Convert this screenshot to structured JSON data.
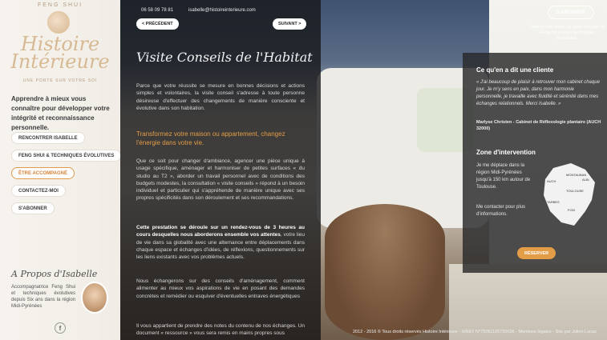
{
  "sidebar": {
    "logo_top": "FENG SHUI",
    "logo_title_line1": "Histoire",
    "logo_title_line2": "Intérieure",
    "logo_sub": "UNE PORTE SUR VOTRE SOI",
    "intro": "Apprendre à mieux vous connaître pour développer votre intégrité et reconnaissance personnelle.",
    "nav": [
      {
        "label": "RENCONTRER ISABELLE"
      },
      {
        "label": "FENG SHUI & TECHNIQUES ÉVOLUTIVES"
      },
      {
        "label": "ÊTRE ACCOMPAGNÉ"
      },
      {
        "label": "CONTACTEZ-MOI"
      },
      {
        "label": "S'ABONNER"
      }
    ],
    "about_title": "A Propos d'Isabelle",
    "about_text": "Accompagnatrice Feng Shui et techniques évolutives depuis Six ans dans la région Midi-Pyrénées",
    "facebook_icon": "f"
  },
  "main": {
    "phone": "06 58 09 78 81",
    "email": "isabelle@histoireinterieure.com",
    "prev_label": "< PRÉCÉDENT",
    "next_label": "SUIVANT >",
    "title": "Visite Conseils de l'Habitat",
    "p1": "Parce que votre réussite se mesure en bonnes décisions et actions simples et volontaires, la visite conseil s'adresse à toute personne désireuse d'effectuer des changements de manière consciente et évolutive dans son habitation.",
    "highlight": "Transformez votre maison ou appartement, changez l'énergie dans votre vie.",
    "p2": "Que ce soit pour changer d'ambiance, agencer une pièce unique à usage spécifique, aménager et harmoniser de petites surfaces « du studio au T2 », aborder un travail personnel avec de conditions des budgets modestes, la consultation « visite conseils » répond à un besoin individuel et particulier qui s'appréhende de manière unique avec ses propres spécificités dans son déroulement et ses recommandations.",
    "p3_bold": "Cette prestation se déroule sur un rendez-vous de 3 heures au cours desquelles nous aborderons ensemble vos attentes",
    "p3_rest": ", votre lieu de vie dans sa globalité avec une alternance entre déplacements dans chaque espace et échanges d'idées, de réflexions, questionnements sur les liens existants avec vos problèmes actuels.",
    "p4": "Nous échangerons sur des conseils d'aménagement, comment alimenter au mieux vos aspirations de vie en posant des demandes concrètes et remédier ou esquiver d'éventuelles entraves énergétiques",
    "p5": "Il vous appartient de prendre des notes du contenu de nos échanges. Un document « ressource » vous sera remis en mains propres sous"
  },
  "right": {
    "testimonial_heading": "Ce qu'en a dit une cliente",
    "quote": "« J'ai beaucoup de plaisir à retrouver mon cabinet chaque jour. Je m'y sens en paix, dans mon harmonie personnelle, je travaille avec fluidité et sérénité dans mes échanges relationnels. Merci Isabelle. »",
    "cite": "Marlyse Christen - Cabinet de Réflexologie plantaire (AUCH 32000)",
    "zone_heading": "Zone d'intervention",
    "zone_text": "Je me déplace dans la région Midi-Pyrénées jusqu'à 150 km autour de Toulouse.",
    "contact_text": "Me contacter pour plus d'informations.",
    "reserve_label": "RÉSERVER",
    "map_labels": [
      "AUCH",
      "MONTAUBAN",
      "ALBI",
      "TOULOUSE",
      "FOIX",
      "TARBES"
    ]
  },
  "subscribe": {
    "label": "S'ABONNER",
    "text": "Ouvrez une porte sur votre soi avec le Feng Shui et les techniques évolutives."
  },
  "footer": "2012 - 2016 © Tous droits réservés Histoire Intérieure - SIRET N°75051105700036 - Mentions légales - Site par Julien Lucas"
}
